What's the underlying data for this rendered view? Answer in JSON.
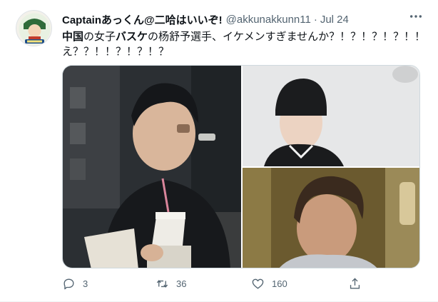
{
  "tweet": {
    "author_name": "Captainあっくん@二哈はいいぞ!",
    "handle": "@akkunakkunn11",
    "separator": "·",
    "time": "Jul 24",
    "text_seg1": "中国",
    "text_seg2": "の女子",
    "text_seg3": "バスケ",
    "text_seg4": "の杨舒予選手、イケメンすぎませんか？！？！？！？！！え？？！！？！？！？"
  },
  "actions": {
    "reply_count": "3",
    "retweet_count": "36",
    "like_count": "160"
  },
  "colors": {
    "text_secondary": "#536471",
    "border": "#cfd9de"
  }
}
